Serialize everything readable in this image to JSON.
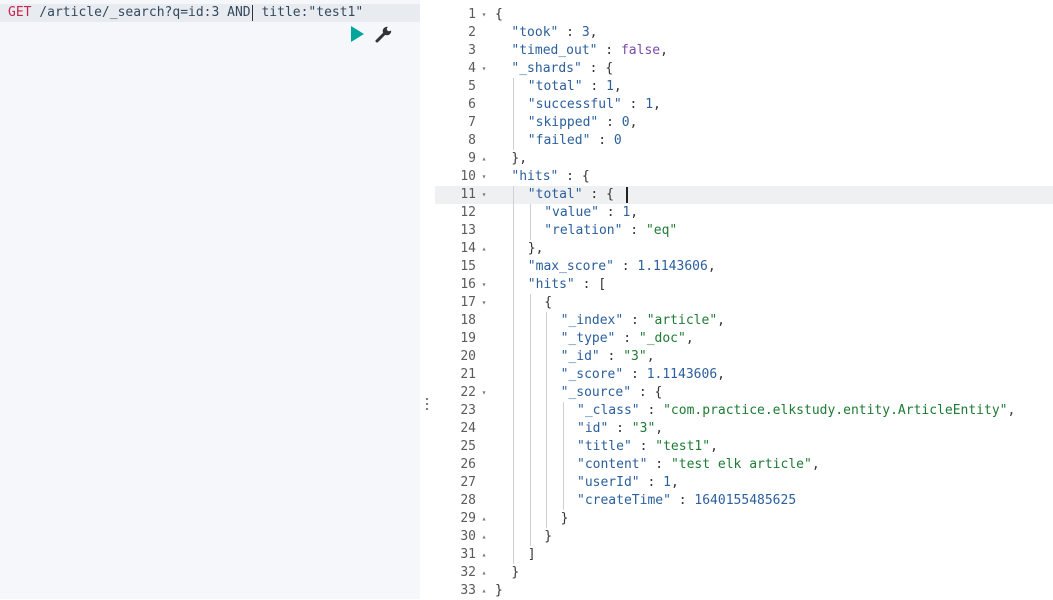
{
  "request": {
    "method": "GET",
    "url_before_cursor": " /article/_search?q=id:3 AND",
    "url_after_cursor": " title:\"test1\""
  },
  "actions": {
    "play_icon": "play-icon",
    "wrench_icon": "wrench-icon"
  },
  "colors": {
    "accent_play": "#00a69b",
    "method": "#c7254e",
    "string": "#1e7b34",
    "number": "#2b5f9c",
    "boolean": "#7b48ab"
  },
  "response": {
    "lines": [
      {
        "n": "1",
        "fold": "▾",
        "indent": 0,
        "parts": [
          [
            "p",
            "{"
          ]
        ]
      },
      {
        "n": "2",
        "fold": "",
        "indent": 1,
        "parts": [
          [
            "k",
            "\"took\""
          ],
          [
            "p",
            " : "
          ],
          [
            "n",
            "3"
          ],
          [
            "p",
            ","
          ]
        ]
      },
      {
        "n": "3",
        "fold": "",
        "indent": 1,
        "parts": [
          [
            "k",
            "\"timed_out\""
          ],
          [
            "p",
            " : "
          ],
          [
            "b",
            "false"
          ],
          [
            "p",
            ","
          ]
        ]
      },
      {
        "n": "4",
        "fold": "▾",
        "indent": 1,
        "parts": [
          [
            "k",
            "\"_shards\""
          ],
          [
            "p",
            " : {"
          ]
        ]
      },
      {
        "n": "5",
        "fold": "",
        "indent": 2,
        "parts": [
          [
            "k",
            "\"total\""
          ],
          [
            "p",
            " : "
          ],
          [
            "n",
            "1"
          ],
          [
            "p",
            ","
          ]
        ]
      },
      {
        "n": "6",
        "fold": "",
        "indent": 2,
        "parts": [
          [
            "k",
            "\"successful\""
          ],
          [
            "p",
            " : "
          ],
          [
            "n",
            "1"
          ],
          [
            "p",
            ","
          ]
        ]
      },
      {
        "n": "7",
        "fold": "",
        "indent": 2,
        "parts": [
          [
            "k",
            "\"skipped\""
          ],
          [
            "p",
            " : "
          ],
          [
            "n",
            "0"
          ],
          [
            "p",
            ","
          ]
        ]
      },
      {
        "n": "8",
        "fold": "",
        "indent": 2,
        "parts": [
          [
            "k",
            "\"failed\""
          ],
          [
            "p",
            " : "
          ],
          [
            "n",
            "0"
          ]
        ]
      },
      {
        "n": "9",
        "fold": "▴",
        "indent": 1,
        "parts": [
          [
            "p",
            "},"
          ]
        ]
      },
      {
        "n": "10",
        "fold": "▾",
        "indent": 1,
        "parts": [
          [
            "k",
            "\"hits\""
          ],
          [
            "p",
            " : {"
          ]
        ]
      },
      {
        "n": "11",
        "fold": "▾",
        "indent": 2,
        "parts": [
          [
            "k",
            "\"total\""
          ],
          [
            "p",
            " : {"
          ]
        ]
      },
      {
        "n": "12",
        "fold": "",
        "indent": 3,
        "parts": [
          [
            "k",
            "\"value\""
          ],
          [
            "p",
            " : "
          ],
          [
            "n",
            "1"
          ],
          [
            "p",
            ","
          ]
        ]
      },
      {
        "n": "13",
        "fold": "",
        "indent": 3,
        "parts": [
          [
            "k",
            "\"relation\""
          ],
          [
            "p",
            " : "
          ],
          [
            "s",
            "\"eq\""
          ]
        ]
      },
      {
        "n": "14",
        "fold": "▴",
        "indent": 2,
        "parts": [
          [
            "p",
            "},"
          ]
        ]
      },
      {
        "n": "15",
        "fold": "",
        "indent": 2,
        "parts": [
          [
            "k",
            "\"max_score\""
          ],
          [
            "p",
            " : "
          ],
          [
            "n",
            "1.1143606"
          ],
          [
            "p",
            ","
          ]
        ]
      },
      {
        "n": "16",
        "fold": "▾",
        "indent": 2,
        "parts": [
          [
            "k",
            "\"hits\""
          ],
          [
            "p",
            " : ["
          ]
        ]
      },
      {
        "n": "17",
        "fold": "▾",
        "indent": 3,
        "parts": [
          [
            "p",
            "{"
          ]
        ]
      },
      {
        "n": "18",
        "fold": "",
        "indent": 4,
        "parts": [
          [
            "k",
            "\"_index\""
          ],
          [
            "p",
            " : "
          ],
          [
            "s",
            "\"article\""
          ],
          [
            "p",
            ","
          ]
        ]
      },
      {
        "n": "19",
        "fold": "",
        "indent": 4,
        "parts": [
          [
            "k",
            "\"_type\""
          ],
          [
            "p",
            " : "
          ],
          [
            "s",
            "\"_doc\""
          ],
          [
            "p",
            ","
          ]
        ]
      },
      {
        "n": "20",
        "fold": "",
        "indent": 4,
        "parts": [
          [
            "k",
            "\"_id\""
          ],
          [
            "p",
            " : "
          ],
          [
            "s",
            "\"3\""
          ],
          [
            "p",
            ","
          ]
        ]
      },
      {
        "n": "21",
        "fold": "",
        "indent": 4,
        "parts": [
          [
            "k",
            "\"_score\""
          ],
          [
            "p",
            " : "
          ],
          [
            "n",
            "1.1143606"
          ],
          [
            "p",
            ","
          ]
        ]
      },
      {
        "n": "22",
        "fold": "▾",
        "indent": 4,
        "parts": [
          [
            "k",
            "\"_source\""
          ],
          [
            "p",
            " : {"
          ]
        ]
      },
      {
        "n": "23",
        "fold": "",
        "indent": 5,
        "parts": [
          [
            "k",
            "\"_class\""
          ],
          [
            "p",
            " : "
          ],
          [
            "s",
            "\"com.practice.elkstudy.entity.ArticleEntity\""
          ],
          [
            "p",
            ","
          ]
        ]
      },
      {
        "n": "24",
        "fold": "",
        "indent": 5,
        "parts": [
          [
            "k",
            "\"id\""
          ],
          [
            "p",
            " : "
          ],
          [
            "s",
            "\"3\""
          ],
          [
            "p",
            ","
          ]
        ]
      },
      {
        "n": "25",
        "fold": "",
        "indent": 5,
        "parts": [
          [
            "k",
            "\"title\""
          ],
          [
            "p",
            " : "
          ],
          [
            "s",
            "\"test1\""
          ],
          [
            "p",
            ","
          ]
        ]
      },
      {
        "n": "26",
        "fold": "",
        "indent": 5,
        "parts": [
          [
            "k",
            "\"content\""
          ],
          [
            "p",
            " : "
          ],
          [
            "s",
            "\"test elk article\""
          ],
          [
            "p",
            ","
          ]
        ]
      },
      {
        "n": "27",
        "fold": "",
        "indent": 5,
        "parts": [
          [
            "k",
            "\"userId\""
          ],
          [
            "p",
            " : "
          ],
          [
            "n",
            "1"
          ],
          [
            "p",
            ","
          ]
        ]
      },
      {
        "n": "28",
        "fold": "",
        "indent": 5,
        "parts": [
          [
            "k",
            "\"createTime\""
          ],
          [
            "p",
            " : "
          ],
          [
            "n",
            "1640155485625"
          ]
        ]
      },
      {
        "n": "29",
        "fold": "▴",
        "indent": 4,
        "parts": [
          [
            "p",
            "}"
          ]
        ]
      },
      {
        "n": "30",
        "fold": "▴",
        "indent": 3,
        "parts": [
          [
            "p",
            "}"
          ]
        ]
      },
      {
        "n": "31",
        "fold": "▴",
        "indent": 2,
        "parts": [
          [
            "p",
            "]"
          ]
        ]
      },
      {
        "n": "32",
        "fold": "▴",
        "indent": 1,
        "parts": [
          [
            "p",
            "}"
          ]
        ]
      },
      {
        "n": "33",
        "fold": "▴",
        "indent": 0,
        "parts": [
          [
            "p",
            "}"
          ]
        ]
      }
    ]
  }
}
